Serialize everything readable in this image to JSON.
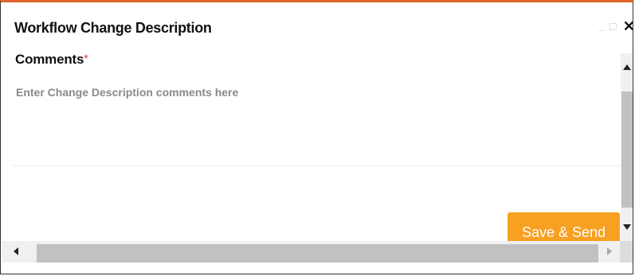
{
  "dialog": {
    "title": "Workflow Change Description",
    "close_icon": "close-icon",
    "minimize_icon": "minimize-icon",
    "maximize_icon": "maximize-icon"
  },
  "form": {
    "comments_label": "Comments",
    "required_marker": "*",
    "comments_placeholder": "Enter Change Description comments here",
    "comments_value": ""
  },
  "actions": {
    "save_send_label": "Save & Send"
  },
  "colors": {
    "accent": "#e0662a",
    "button": "#f7a021",
    "required": "#e53935"
  }
}
